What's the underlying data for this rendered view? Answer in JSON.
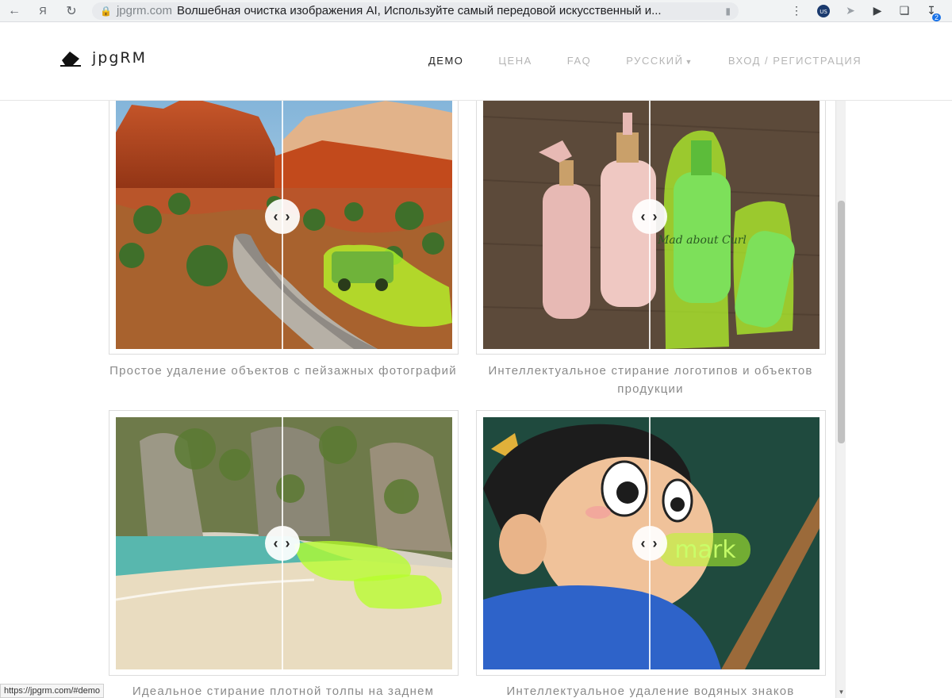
{
  "browser": {
    "domain": "jpgrm.com",
    "tab_title": "Волшебная очистка изображения AI, Используйте самый передовой искусственный и...",
    "ext_badge": "2",
    "ext_us": "US"
  },
  "status_url": "https://jpgrm.com/#demo",
  "logo": {
    "text": "jpgRM"
  },
  "nav": [
    {
      "label": "ДЕМО",
      "active": true
    },
    {
      "label": "ЦЕНА"
    },
    {
      "label": "FAQ"
    },
    {
      "label": "РУССКИЙ"
    },
    {
      "label": "ВХОД / РЕГИСТРАЦИЯ"
    }
  ],
  "gallery": [
    {
      "caption": "Простое удаление объектов с пейзажных фотографий"
    },
    {
      "caption": "Интеллектуальное стирание логотипов и объектов продукции"
    },
    {
      "caption": "Идеальное стирание плотной толпы на заднем"
    },
    {
      "caption": "Интеллектуальное удаление водяных знаков"
    }
  ],
  "watermark_text": "mark",
  "bottle_text": "Mad about Curl",
  "handle_glyph": "‹ ›",
  "colors": {
    "highlight": "#b6ff2a",
    "nav_active": "#222222",
    "nav_muted": "#b5b5b5"
  }
}
